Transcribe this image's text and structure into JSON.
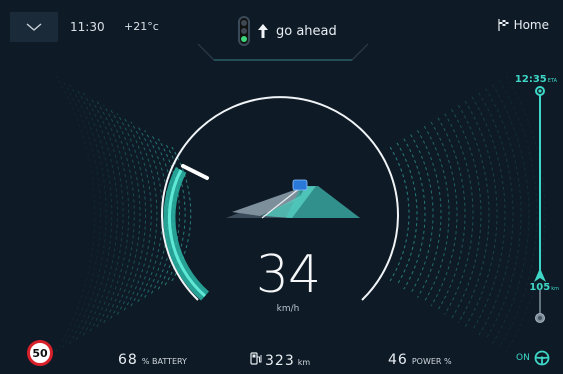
{
  "topbar": {
    "time": "11:30",
    "temperature": "+21°c",
    "home_label": "Home"
  },
  "navigation": {
    "instruction": "go ahead",
    "traffic_light": "green"
  },
  "speedometer": {
    "speed": "34",
    "unit": "km/h",
    "max_speed_fraction": 0.55
  },
  "route": {
    "eta_time": "12:35",
    "eta_suffix": "ETA",
    "distance": "105",
    "distance_unit": "km"
  },
  "status": {
    "speed_limit": "50",
    "battery_value": "68",
    "battery_label": "% BATTERY",
    "range_value": "323",
    "range_unit": "km",
    "power_value": "46",
    "power_label": "POWER %",
    "autopilot_label": "ON"
  },
  "colors": {
    "accent": "#3ed6c6",
    "background": "#0e1a26",
    "limit_ring": "#d8202a"
  }
}
